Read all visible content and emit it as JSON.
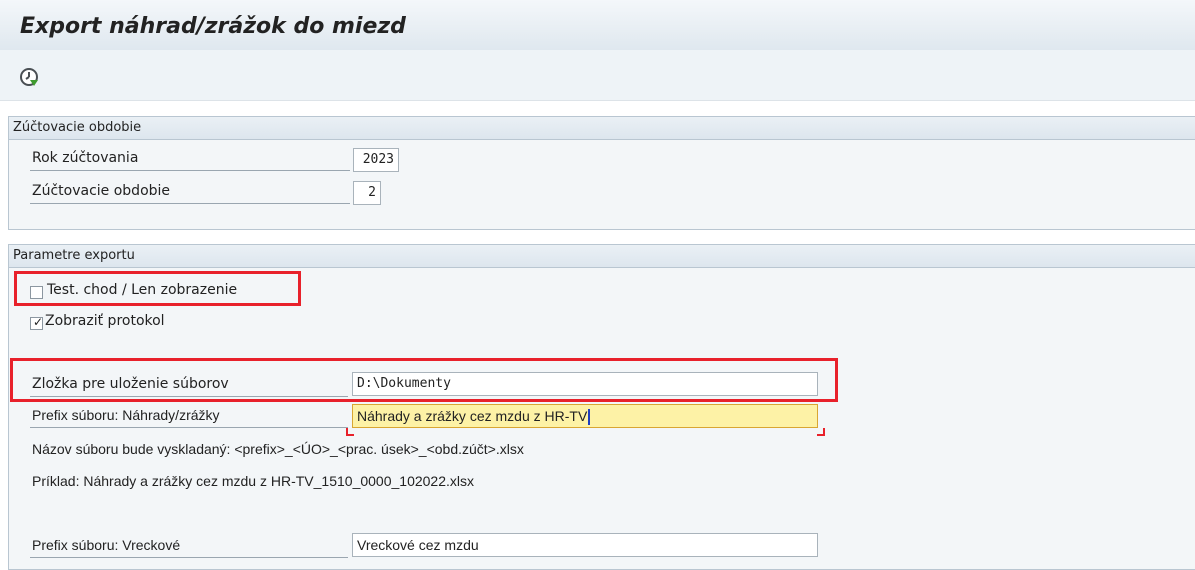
{
  "window": {
    "title": "Export náhrad/zrážok do miezd"
  },
  "toolbar": {
    "execute_icon": "execute-clock-icon"
  },
  "group_period": {
    "title": "Zúčtovacie obdobie",
    "year_label": "Rok zúčtovania",
    "year_value": "2023",
    "period_label": "Zúčtovacie obdobie",
    "period_value": "2"
  },
  "group_export": {
    "title": "Parametre exportu",
    "test_run_label": "Test. chod / Len zobrazenie",
    "test_run_checked": false,
    "show_protocol_label": "Zobraziť protokol",
    "show_protocol_checked": true,
    "folder_label": "Zložka pre uloženie súborov",
    "folder_value": "D:\\Dokumenty",
    "prefix_label": "Prefix súboru: Náhrady/zrážky",
    "prefix_value": "Náhrady a zrážky cez mzdu z HR-TV",
    "info_line_1": "Názov súboru bude vyskladaný: <prefix>_<ÚO>_<prac. úsek>_<obd.zúčt>.xlsx",
    "info_line_2": "Príklad: Náhrady a zrážky cez mzdu z HR-TV_1510_0000_102022.xlsx",
    "pocket_label": "Prefix súboru: Vreckové",
    "pocket_value": "Vreckové cez mzdu"
  },
  "colors": {
    "highlight": "#e8212b",
    "active_field": "#fdf2a6"
  }
}
